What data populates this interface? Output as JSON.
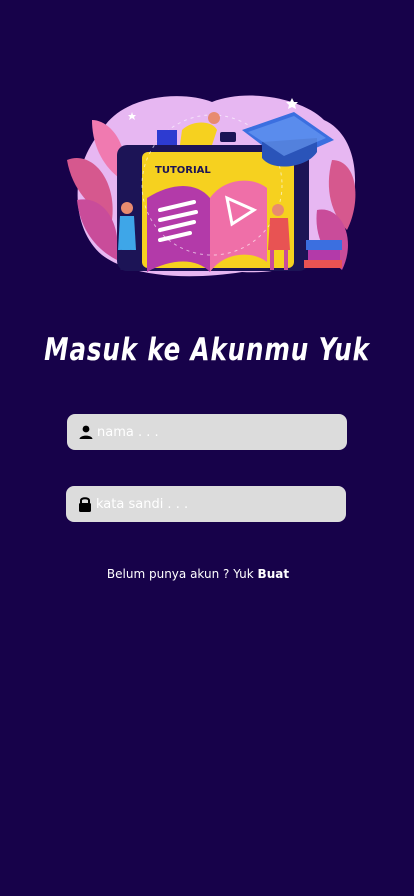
{
  "illustration": {
    "board_label": "TUTORIAL"
  },
  "login": {
    "title": "Masuk ke Akunmu Yuk",
    "name_placeholder": "nama . . .",
    "password_placeholder": "kata sandi . . ."
  },
  "signup": {
    "prompt": "Belum punya akun ? Yuk ",
    "link_label": "Buat"
  },
  "colors": {
    "background": "#17024a",
    "field": "#dcdcdc",
    "text": "#ffffff"
  }
}
